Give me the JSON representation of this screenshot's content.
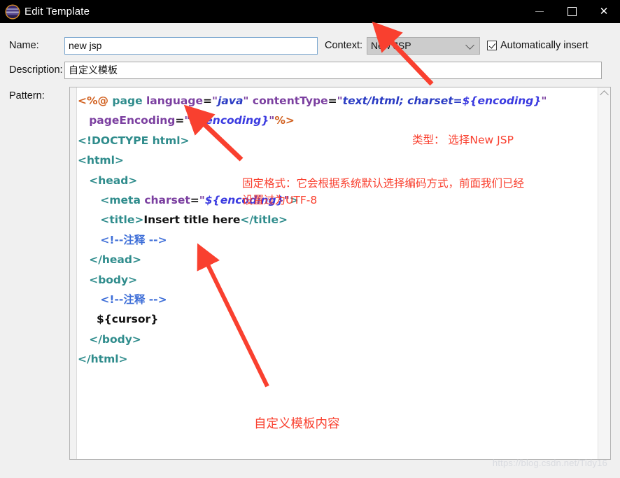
{
  "window": {
    "title": "Edit Template",
    "icon": "eclipse-logo-icon",
    "minimize_label": "─",
    "maximize_label": "□",
    "close_label": "✕"
  },
  "form": {
    "name_label": "Name:",
    "name_value": "new jsp",
    "context_label": "Context:",
    "context_value": "New JSP",
    "context_options": [
      "New JSP"
    ],
    "auto_insert_label": "Automatically insert",
    "auto_insert_checked": true,
    "description_label": "Description:",
    "description_value": "自定义模板",
    "pattern_label": "Pattern:"
  },
  "code": {
    "lines": [
      [
        {
          "t": "<%@ ",
          "c": "t-jsp"
        },
        {
          "t": "page ",
          "c": "t-kw"
        },
        {
          "t": "language",
          "c": "t-attr"
        },
        {
          "t": "=",
          "c": "t-plain"
        },
        {
          "t": "\"",
          "c": "t-str"
        },
        {
          "t": "java",
          "c": "t-val"
        },
        {
          "t": "\" ",
          "c": "t-str"
        },
        {
          "t": "contentType",
          "c": "t-attr"
        },
        {
          "t": "=",
          "c": "t-plain"
        },
        {
          "t": "\"",
          "c": "t-str"
        },
        {
          "t": "text/html; charset=",
          "c": "t-val"
        },
        {
          "t": "${encoding}",
          "c": "t-var"
        },
        {
          "t": "\"",
          "c": "t-str"
        }
      ],
      [
        {
          "t": "   ",
          "c": "t-plain"
        },
        {
          "t": "pageEncoding",
          "c": "t-attr"
        },
        {
          "t": "=",
          "c": "t-plain"
        },
        {
          "t": "\"",
          "c": "t-str"
        },
        {
          "t": "${encoding}",
          "c": "t-var"
        },
        {
          "t": "\"",
          "c": "t-str"
        },
        {
          "t": "%>",
          "c": "t-jsp"
        }
      ],
      [
        {
          "t": "<!DOCTYPE html>",
          "c": "t-tag"
        }
      ],
      [
        {
          "t": "<html>",
          "c": "t-tag"
        }
      ],
      [
        {
          "t": "   ",
          "c": "t-plain"
        },
        {
          "t": "<head>",
          "c": "t-tag"
        }
      ],
      [
        {
          "t": "      ",
          "c": "t-plain"
        },
        {
          "t": "<meta ",
          "c": "t-tag"
        },
        {
          "t": "charset",
          "c": "t-attr"
        },
        {
          "t": "=",
          "c": "t-plain"
        },
        {
          "t": "\"",
          "c": "t-str"
        },
        {
          "t": "${encoding}",
          "c": "t-var"
        },
        {
          "t": "\"",
          "c": "t-str"
        },
        {
          "t": ">",
          "c": "t-tag"
        }
      ],
      [
        {
          "t": "      ",
          "c": "t-plain"
        },
        {
          "t": "<title>",
          "c": "t-tag"
        },
        {
          "t": "Insert title here",
          "c": "t-plain"
        },
        {
          "t": "</title>",
          "c": "t-tag"
        }
      ],
      [
        {
          "t": "      ",
          "c": "t-plain"
        },
        {
          "t": "<!--注释 -->",
          "c": "t-cmt"
        }
      ],
      [
        {
          "t": "   ",
          "c": "t-plain"
        },
        {
          "t": "</head>",
          "c": "t-tag"
        }
      ],
      [
        {
          "t": "   ",
          "c": "t-plain"
        },
        {
          "t": "<body>",
          "c": "t-tag"
        }
      ],
      [
        {
          "t": "      ",
          "c": "t-plain"
        },
        {
          "t": "<!--注释 -->",
          "c": "t-cmt"
        }
      ],
      [
        {
          "t": "     ",
          "c": "t-plain"
        },
        {
          "t": "${cursor}",
          "c": "t-plain"
        }
      ],
      [
        {
          "t": "   ",
          "c": "t-plain"
        },
        {
          "t": "</body>",
          "c": "t-tag"
        }
      ],
      [
        {
          "t": "</html>",
          "c": "t-tag"
        }
      ]
    ]
  },
  "annotations": {
    "type_note": "类型： 选择New JSP",
    "fixed_note_line1": "固定格式：它会根据系统默认选择编码方式，前面我们已经",
    "fixed_note_line2": "设置过为UTF-8",
    "body_note": "自定义模板内容"
  },
  "watermark": "https://blog.csdn.net/Tidy16",
  "colors": {
    "annotation_red": "#f9402f",
    "titlebar_bg": "#000000",
    "dialog_bg": "#f0f0f0",
    "focus_border": "#7ba7cf"
  }
}
